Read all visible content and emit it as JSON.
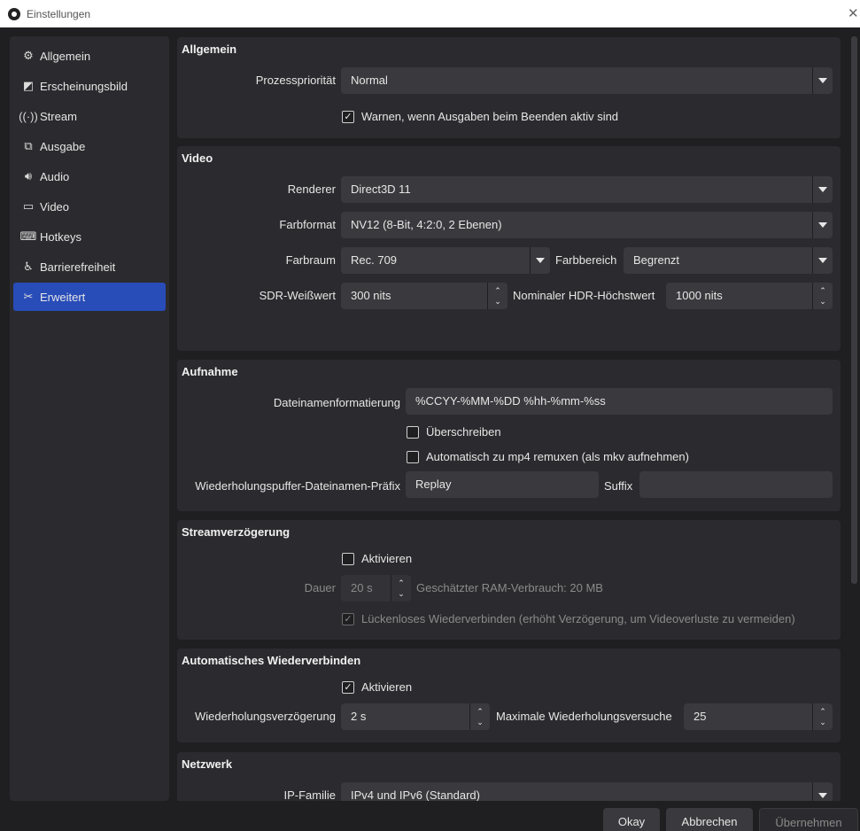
{
  "window": {
    "title": "Einstellungen"
  },
  "sidebar": {
    "items": [
      {
        "label": "Allgemein",
        "icon": "gear-icon"
      },
      {
        "label": "Erscheinungsbild",
        "icon": "appearance-icon"
      },
      {
        "label": "Stream",
        "icon": "broadcast-icon"
      },
      {
        "label": "Ausgabe",
        "icon": "output-icon"
      },
      {
        "label": "Audio",
        "icon": "speaker-icon"
      },
      {
        "label": "Video",
        "icon": "monitor-icon"
      },
      {
        "label": "Hotkeys",
        "icon": "keyboard-icon"
      },
      {
        "label": "Barrierefreiheit",
        "icon": "accessibility-icon"
      },
      {
        "label": "Erweitert",
        "icon": "tools-icon",
        "active": true
      }
    ]
  },
  "general": {
    "title": "Allgemein",
    "priority_label": "Prozesspriorität",
    "priority_value": "Normal",
    "warn_label": "Warnen, wenn Ausgaben beim Beenden aktiv sind"
  },
  "video": {
    "title": "Video",
    "renderer_label": "Renderer",
    "renderer_value": "Direct3D 11",
    "format_label": "Farbformat",
    "format_value": "NV12 (8-Bit, 4:2:0, 2 Ebenen)",
    "space_label": "Farbraum",
    "space_value": "Rec. 709",
    "range_label": "Farbbereich",
    "range_value": "Begrenzt",
    "sdr_label": "SDR-Weißwert",
    "sdr_value": "300 nits",
    "hdr_label": "Nominaler HDR-Höchstwert",
    "hdr_value": "1000 nits"
  },
  "recording": {
    "title": "Aufnahme",
    "filename_label": "Dateinamenformatierung",
    "filename_value": "%CCYY-%MM-%DD %hh-%mm-%ss",
    "overwrite_label": "Überschreiben",
    "remux_label": "Automatisch zu mp4 remuxen (als mkv aufnehmen)",
    "prefix_label": "Wiederholungspuffer-Dateinamen-Präfix",
    "prefix_value": "Replay",
    "suffix_label": "Suffix",
    "suffix_value": ""
  },
  "stream_delay": {
    "title": "Streamverzögerung",
    "enable_label": "Aktivieren",
    "duration_label": "Dauer",
    "duration_value": "20 s",
    "ram_text": "Geschätzter RAM-Verbrauch: 20 MB",
    "seamless_label": "Lückenloses Wiederverbinden (erhöht Verzögerung, um Videoverluste zu vermeiden)"
  },
  "reconnect": {
    "title": "Automatisches Wiederverbinden",
    "enable_label": "Aktivieren",
    "delay_label": "Wiederholungsverzögerung",
    "delay_value": "2 s",
    "max_label": "Maximale Wiederholungsversuche",
    "max_value": "25"
  },
  "network": {
    "title": "Netzwerk",
    "ip_label": "IP-Familie",
    "ip_value": "IPv4 und IPv6 (Standard)"
  },
  "buttons": {
    "ok": "Okay",
    "cancel": "Abbrechen",
    "apply": "Übernehmen"
  },
  "colors": {
    "accent": "#284cb8",
    "background": "#1f1e21",
    "panel": "#2b2a2e",
    "input": "#3a393d"
  }
}
